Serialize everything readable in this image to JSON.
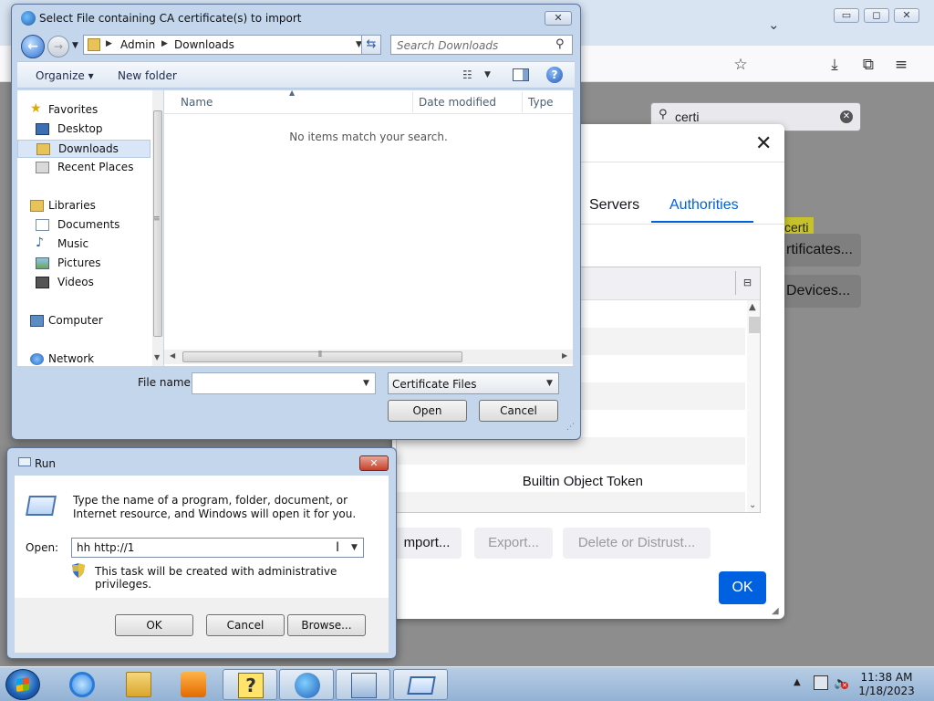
{
  "firefox": {
    "search_value": "certi",
    "highlight_text": "certi",
    "behind_buttons": [
      "rtificates...",
      "Devices..."
    ]
  },
  "cert_manager": {
    "tabs": [
      "Servers",
      "Authorities"
    ],
    "active_tab": "Authorities",
    "row_text": "Builtin Object Token",
    "buttons": {
      "import": "mport...",
      "export": "Export...",
      "delete": "Delete or Distrust..."
    },
    "ok_label": "OK"
  },
  "file_dialog": {
    "title": "Select File containing CA certificate(s) to import",
    "breadcrumb": [
      "Admin",
      "Downloads"
    ],
    "search_placeholder": "Search Downloads",
    "toolbar": {
      "organize": "Organize ▾",
      "new_folder": "New folder"
    },
    "nav": {
      "favorites_label": "Favorites",
      "favorites": [
        "Desktop",
        "Downloads",
        "Recent Places"
      ],
      "libraries_label": "Libraries",
      "libraries": [
        "Documents",
        "Music",
        "Pictures",
        "Videos"
      ],
      "computer": "Computer",
      "network": "Network"
    },
    "columns": [
      "Name",
      "Date modified",
      "Type"
    ],
    "empty_text": "No items match your search.",
    "file_name_label": "File name:",
    "file_name_value": "",
    "filter_value": "Certificate Files",
    "open_label": "Open",
    "cancel_label": "Cancel"
  },
  "run_dialog": {
    "title": "Run",
    "description": "Type the name of a program, folder, document, or Internet resource, and Windows will open it for you.",
    "open_label": "Open:",
    "open_value": "hh http://1",
    "admin_note": "This task will be created with administrative privileges.",
    "ok_label": "OK",
    "cancel_label": "Cancel",
    "browse_label": "Browse..."
  },
  "taskbar": {
    "time": "11:38 AM",
    "date": "1/18/2023"
  }
}
